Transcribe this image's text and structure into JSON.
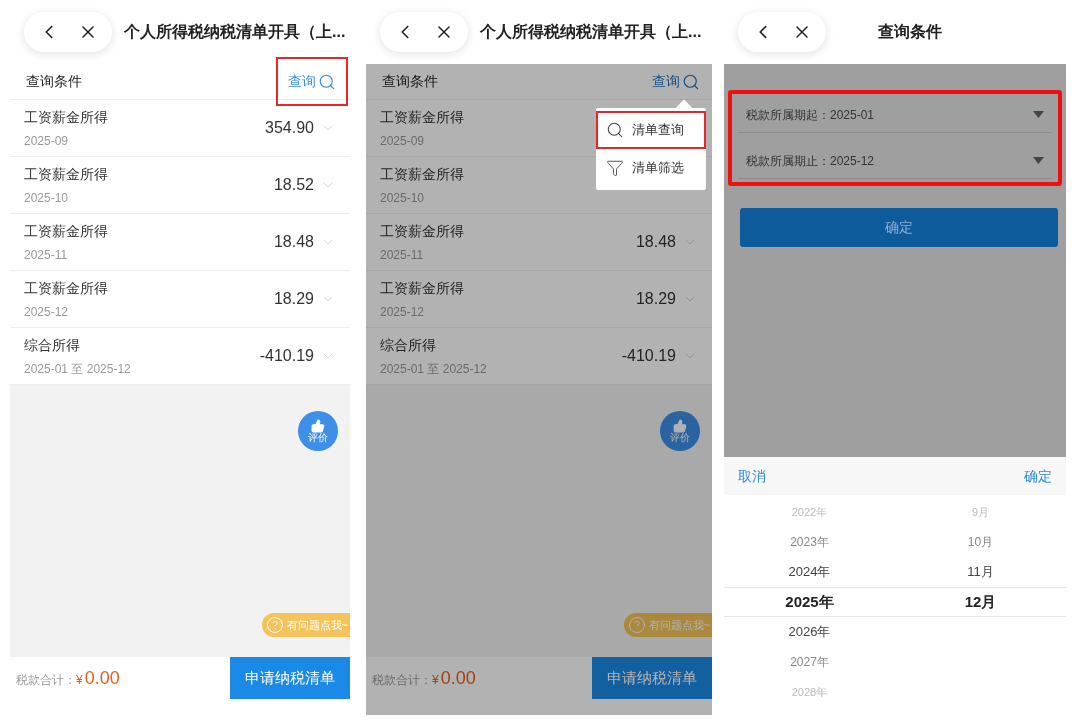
{
  "screens": [
    {
      "kind": "list",
      "title": "个人所得税纳税清单开具（上...",
      "dimmed": false,
      "query": {
        "label": "查询条件",
        "button": "查询",
        "highlighted": true
      },
      "rows": [
        {
          "name": "工资薪金所得",
          "period": "2025-09",
          "amount": "354.90"
        },
        {
          "name": "工资薪金所得",
          "period": "2025-10",
          "amount": "18.52"
        },
        {
          "name": "工资薪金所得",
          "period": "2025-11",
          "amount": "18.48"
        },
        {
          "name": "工资薪金所得",
          "period": "2025-12",
          "amount": "18.29"
        },
        {
          "name": "综合所得",
          "period": "2025-01 至 2025-12",
          "amount": "-410.19"
        }
      ],
      "rate_badge": "评价",
      "help": "有问题点我~",
      "total_label": "税款合计：",
      "currency": "¥",
      "total": "0.00",
      "apply_button": "申请纳税清单"
    },
    {
      "kind": "list",
      "title": "个人所得税纳税清单开具（上...",
      "dimmed": true,
      "query": {
        "label": "查询条件",
        "button": "查询",
        "highlighted": false
      },
      "rows": [
        {
          "name": "工资薪金所得",
          "period": "2025-09"
        },
        {
          "name": "工资薪金所得",
          "period": "2025-10"
        },
        {
          "name": "工资薪金所得",
          "period": "2025-11",
          "amount": "18.48"
        },
        {
          "name": "工资薪金所得",
          "period": "2025-12",
          "amount": "18.29"
        },
        {
          "name": "综合所得",
          "period": "2025-01 至 2025-12",
          "amount": "-410.19"
        }
      ],
      "menu": [
        {
          "kind": "search",
          "label": "清单查询",
          "highlighted": true
        },
        {
          "kind": "filter",
          "label": "清单筛选",
          "highlighted": false
        }
      ],
      "rate_badge": "评价",
      "help": "有问题点我~",
      "total_label": "税款合计：",
      "currency": "¥",
      "total": "0.00",
      "apply_button": "申请纳税清单"
    },
    {
      "kind": "form",
      "title": "查询条件",
      "dimmed": true,
      "fields_highlighted": true,
      "fields": [
        {
          "label": "税款所属期起：",
          "value": "2025-01"
        },
        {
          "label": "税款所属期止：",
          "value": "2025-12"
        }
      ],
      "confirm_button": "确定",
      "picker": {
        "cancel": "取消",
        "ok": "确定",
        "years": [
          {
            "label": "2022年",
            "selected": false
          },
          {
            "label": "2023年",
            "selected": false
          },
          {
            "label": "2024年",
            "selected": false
          },
          {
            "label": "2025年",
            "selected": true
          },
          {
            "label": "2026年",
            "selected": false
          },
          {
            "label": "2027年",
            "selected": false
          },
          {
            "label": "2028年",
            "selected": false
          }
        ],
        "months": [
          {
            "label": "9月",
            "selected": false
          },
          {
            "label": "10月",
            "selected": false
          },
          {
            "label": "11月",
            "selected": false
          },
          {
            "label": "12月",
            "selected": true
          }
        ]
      }
    }
  ]
}
